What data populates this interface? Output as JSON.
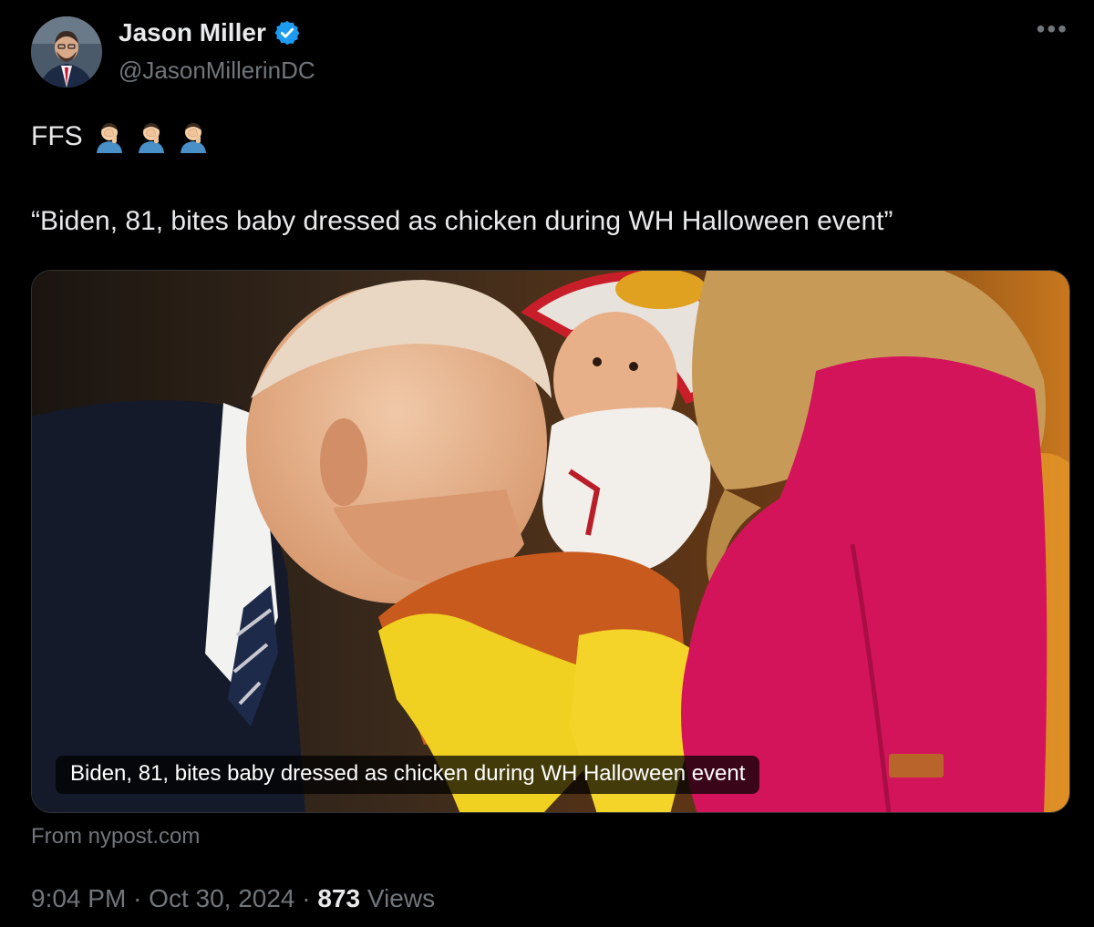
{
  "author": {
    "display_name": "Jason Miller",
    "handle": "@JasonMillerinDC",
    "verified_icon": "verified-badge-icon"
  },
  "post": {
    "text_line1": "FFS",
    "emoji": [
      "facepalm-emoji",
      "facepalm-emoji",
      "facepalm-emoji"
    ],
    "text_line2": "“Biden, 81, bites baby dressed as chicken during WH Halloween event”"
  },
  "link_card": {
    "caption": "Biden, 81, bites baby dressed as chicken during WH Halloween event",
    "source": "From nypost.com"
  },
  "meta": {
    "time": "9:04 PM",
    "separator": "·",
    "date": "Oct 30, 2024",
    "views_count": "873",
    "views_label": "Views"
  },
  "colors": {
    "background": "#000000",
    "primary_text": "#e7e9ea",
    "secondary_text": "#71767b",
    "verified_blue": "#1d9bf0"
  }
}
